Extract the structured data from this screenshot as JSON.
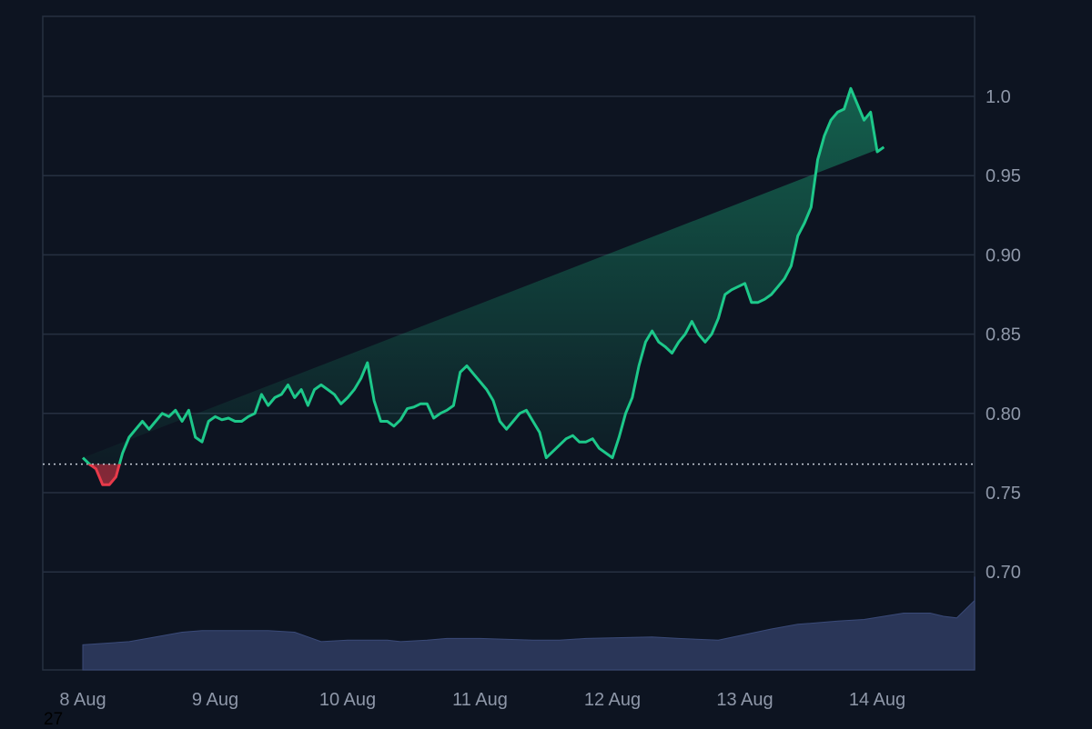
{
  "chart_data": {
    "type": "area",
    "title": "",
    "xlabel": "",
    "ylabel": "",
    "x_ticks": [
      "8 Aug",
      "9 Aug",
      "10 Aug",
      "11 Aug",
      "12 Aug",
      "13 Aug",
      "14 Aug"
    ],
    "y_ticks": [
      "0.70",
      "0.75",
      "0.80",
      "0.85",
      "0.90",
      "0.95",
      "1.0"
    ],
    "ylim": [
      0.637,
      1.05
    ],
    "grid": true,
    "baseline": 0.768,
    "x_range_days": [
      0,
      7.02
    ],
    "price_series": {
      "name": "",
      "x": [
        0,
        0.05,
        0.1,
        0.15,
        0.2,
        0.25,
        0.3,
        0.35,
        0.4,
        0.45,
        0.5,
        0.55,
        0.6,
        0.65,
        0.7,
        0.75,
        0.8,
        0.85,
        0.9,
        0.95,
        1.0,
        1.05,
        1.1,
        1.15,
        1.2,
        1.25,
        1.3,
        1.35,
        1.4,
        1.45,
        1.5,
        1.55,
        1.6,
        1.65,
        1.7,
        1.75,
        1.8,
        1.85,
        1.9,
        1.95,
        2.0,
        2.05,
        2.1,
        2.15,
        2.2,
        2.25,
        2.3,
        2.35,
        2.4,
        2.45,
        2.5,
        2.55,
        2.6,
        2.65,
        2.7,
        2.75,
        2.8,
        2.85,
        2.9,
        2.95,
        3.0,
        3.05,
        3.1,
        3.15,
        3.2,
        3.25,
        3.3,
        3.35,
        3.4,
        3.45,
        3.5,
        3.55,
        3.6,
        3.65,
        3.7,
        3.75,
        3.8,
        3.85,
        3.9,
        3.95,
        4.0,
        4.05,
        4.1,
        4.15,
        4.2,
        4.25,
        4.3,
        4.35,
        4.4,
        4.45,
        4.5,
        4.55,
        4.6,
        4.65,
        4.7,
        4.75,
        4.8,
        4.85,
        4.9,
        4.95,
        5.0,
        5.05,
        5.1,
        5.15,
        5.2,
        5.25,
        5.3,
        5.35,
        5.4,
        5.45,
        5.5,
        5.55,
        5.6,
        5.65,
        5.7,
        5.75,
        5.8,
        5.85,
        5.9,
        5.95,
        6.0,
        6.05,
        6.1,
        6.15,
        6.2,
        6.25,
        6.3,
        6.35,
        6.4,
        6.45,
        6.5,
        6.55,
        6.6,
        6.65,
        6.7,
        6.75,
        6.8,
        6.85,
        6.9,
        6.95,
        7.0
      ],
      "values": [
        0.772,
        0.768,
        0.765,
        0.755,
        0.755,
        0.76,
        0.775,
        0.785,
        0.79,
        0.795,
        0.79,
        0.795,
        0.8,
        0.798,
        0.802,
        0.795,
        0.802,
        0.785,
        0.782,
        0.795,
        0.798,
        0.796,
        0.797,
        0.795,
        0.795,
        0.798,
        0.8,
        0.812,
        0.805,
        0.81,
        0.812,
        0.818,
        0.81,
        0.815,
        0.805,
        0.815,
        0.818,
        0.815,
        0.812,
        0.806,
        0.81,
        0.815,
        0.822,
        0.832,
        0.808,
        0.795,
        0.795,
        0.792,
        0.796,
        0.803,
        0.804,
        0.806,
        0.806,
        0.797,
        0.8,
        0.802,
        0.805,
        0.826,
        0.83,
        0.825,
        0.82,
        0.815,
        0.808,
        0.795,
        0.79,
        0.795,
        0.8,
        0.802,
        0.795,
        0.788,
        0.772,
        0.776,
        0.78,
        0.784,
        0.786,
        0.782,
        0.782,
        0.784,
        0.778,
        0.775,
        0.772,
        0.785,
        0.8,
        0.81,
        0.83,
        0.845,
        0.852,
        0.845,
        0.842,
        0.838,
        0.845,
        0.85,
        0.858,
        0.85,
        0.845,
        0.85,
        0.86,
        0.875,
        0.878,
        0.88,
        0.882,
        0.87,
        0.87,
        0.872,
        0.875,
        0.88,
        0.885,
        0.893,
        0.912,
        0.92,
        0.93,
        0.96,
        0.975,
        0.985,
        0.99,
        0.992,
        1.005,
        0.995,
        0.985,
        0.99,
        0.965,
        0.968
      ]
    },
    "volume_series": {
      "name": "",
      "x": [
        0,
        0.35,
        0.55,
        0.75,
        0.9,
        1.1,
        1.4,
        1.6,
        1.7,
        1.8,
        2.0,
        2.3,
        2.4,
        2.6,
        2.75,
        3.0,
        3.4,
        3.6,
        3.8,
        4.3,
        4.5,
        4.8,
        5.2,
        5.4,
        5.7,
        5.9,
        6.2,
        6.4,
        6.5,
        6.6,
        6.8,
        6.9,
        7.02
      ],
      "values": [
        0.654,
        0.656,
        0.659,
        0.662,
        0.663,
        0.663,
        0.663,
        0.662,
        0.659,
        0.656,
        0.657,
        0.657,
        0.656,
        0.657,
        0.658,
        0.658,
        0.657,
        0.657,
        0.658,
        0.659,
        0.658,
        0.657,
        0.664,
        0.667,
        0.669,
        0.67,
        0.674,
        0.674,
        0.672,
        0.671,
        0.682,
        0.692,
        0.697
      ]
    },
    "colors": {
      "background": "#0d1421",
      "grid": "#263041",
      "up_line": "#1dc88a",
      "down_line": "#e83a4a",
      "volume": "#2a3658",
      "baseline": "#c9ced8"
    }
  },
  "bottom_note": "27"
}
